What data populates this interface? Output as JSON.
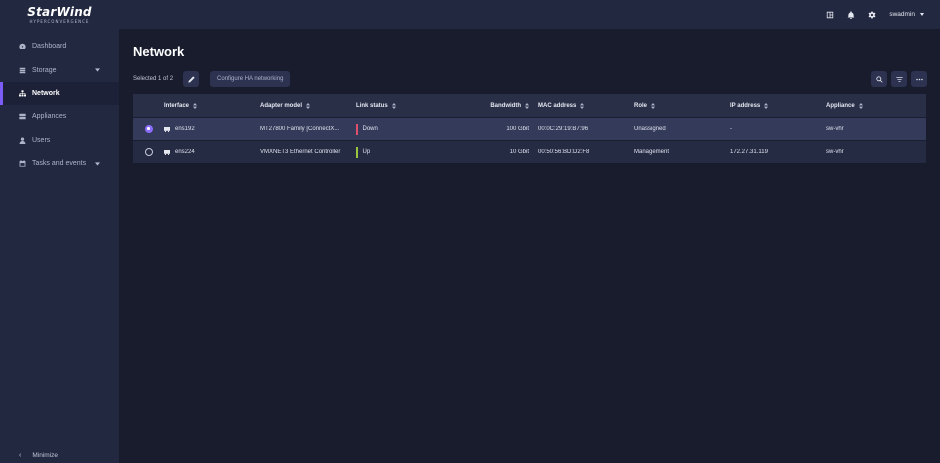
{
  "app": {
    "logo_title": "StarWind",
    "logo_sub": "HYPERCONVERGENCE"
  },
  "sidebar": {
    "items": [
      {
        "label": "Dashboard",
        "icon": "dashboard-icon",
        "active": false,
        "expandable": false
      },
      {
        "label": "Storage",
        "icon": "storage-icon",
        "active": false,
        "expandable": true
      },
      {
        "label": "Network",
        "icon": "network-icon",
        "active": true,
        "expandable": false
      },
      {
        "label": "Appliances",
        "icon": "appliances-icon",
        "active": false,
        "expandable": false
      },
      {
        "label": "Users",
        "icon": "user-icon",
        "active": false,
        "expandable": false
      },
      {
        "label": "Tasks and events",
        "icon": "calendar-icon",
        "active": false,
        "expandable": true
      }
    ],
    "minimize_label": "Minimize"
  },
  "topbar": {
    "icons": [
      "layout-icon",
      "bell-icon",
      "gear-icon"
    ],
    "username": "swadmin"
  },
  "page": {
    "title": "Network",
    "selected_text": "Selected 1 of 2",
    "configure_button": "Configure HA networking"
  },
  "table": {
    "columns": [
      "Interface",
      "Adapter model",
      "Link status",
      "Bandwidth",
      "MAC address",
      "Role",
      "IP address",
      "Appliance"
    ],
    "rows": [
      {
        "selected": true,
        "interface": "ens192",
        "adapter_model": "MT27800 Family [ConnectX...",
        "link_status": "Down",
        "link_color": "#e0506a",
        "bandwidth": "100 Gbit",
        "mac": "00:0C:29:19:B7:96",
        "role": "Unassigned",
        "ip": "-",
        "appliance": "sw-vhr"
      },
      {
        "selected": false,
        "interface": "ens224",
        "adapter_model": "VMXNET3 Ethernet Controller",
        "link_status": "Up",
        "link_color": "#9bc53d",
        "bandwidth": "10 Gbit",
        "mac": "00:50:56:BD:D2:F8",
        "role": "Management",
        "ip": "172.27.31.119",
        "appliance": "sw-vhr"
      }
    ]
  },
  "colors": {
    "accent": "#7b5df5",
    "background": "#181c2d",
    "sidebar": "#222840"
  }
}
